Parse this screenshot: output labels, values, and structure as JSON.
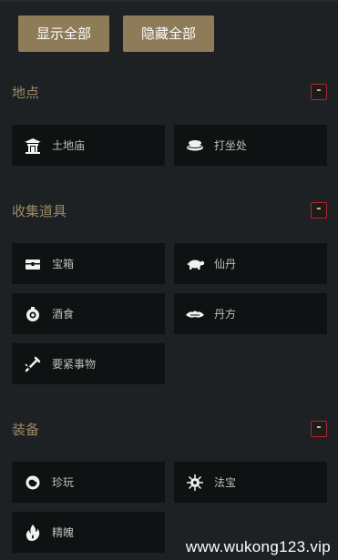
{
  "buttons": {
    "show_all": "显示全部",
    "hide_all": "隐藏全部"
  },
  "sections": [
    {
      "title": "地点",
      "toggle": "-",
      "items": [
        {
          "label": "土地庙",
          "icon": "shrine-icon"
        },
        {
          "label": "打坐处",
          "icon": "meditation-cushion-icon"
        }
      ]
    },
    {
      "title": "收集道具",
      "toggle": "-",
      "items": [
        {
          "label": "宝箱",
          "icon": "chest-icon"
        },
        {
          "label": "仙丹",
          "icon": "turtle-icon"
        },
        {
          "label": "酒食",
          "icon": "wine-gourd-icon"
        },
        {
          "label": "丹方",
          "icon": "recipe-icon"
        },
        {
          "label": "要紧事物",
          "icon": "key-item-icon"
        }
      ]
    },
    {
      "title": "装备",
      "toggle": "-",
      "items": [
        {
          "label": "珍玩",
          "icon": "curio-icon"
        },
        {
          "label": "法宝",
          "icon": "treasure-icon"
        },
        {
          "label": "精魄",
          "icon": "spirit-flame-icon"
        }
      ]
    }
  ],
  "watermark": "www.wukong123.vip",
  "colors": {
    "background": "#1d2123",
    "button": "#8e7b57",
    "section_title": "#9a8a66",
    "item_bg": "#0f1212",
    "toggle_border": "#b3242a"
  }
}
